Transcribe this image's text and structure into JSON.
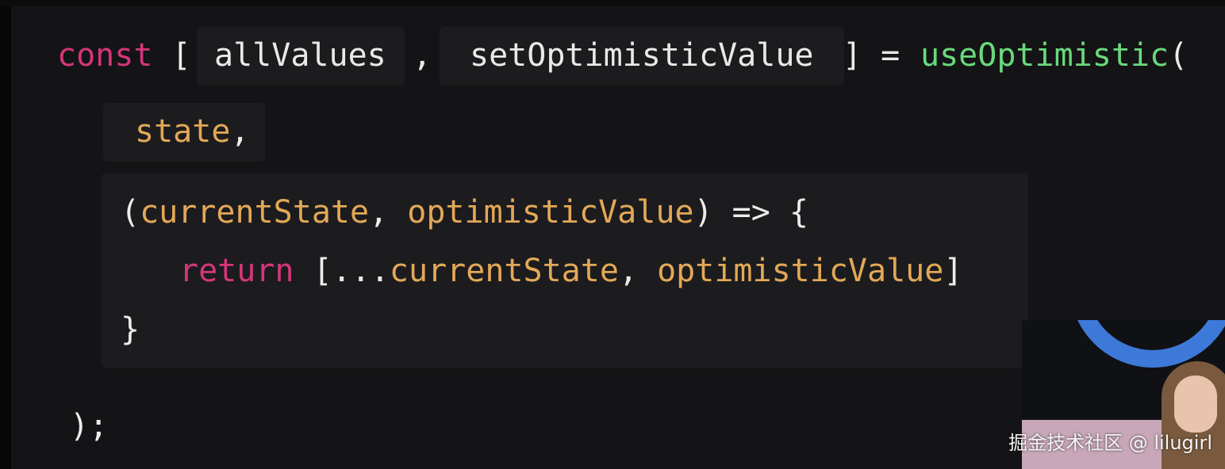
{
  "code": {
    "line1": {
      "keyword": "const",
      "open_bracket": "[",
      "first_binding": "allValues",
      "comma": ",",
      "second_binding": "setOptimisticValue",
      "close_and_assign": "] =",
      "hook_name": "useOptimistic",
      "open_paren": "("
    },
    "line2": {
      "arg": "state",
      "comma": ","
    },
    "line3": {
      "open_paren": "(",
      "param1": "currentState",
      "comma": ",",
      "param2": "optimisticValue",
      "arrow": ") => {"
    },
    "line4": {
      "keyword": "return",
      "spread_open": "[...",
      "item1": "currentState",
      "comma": ",",
      "item2": "optimisticValue",
      "close": "]"
    },
    "line5": {
      "brace": "}"
    },
    "line6": {
      "close": ");"
    }
  },
  "watermark": "掘金技术社区 @ lilugirl",
  "colors": {
    "background": "#141416",
    "keyword": "#d4367a",
    "function": "#69d97c",
    "variable": "#e3a857",
    "highlight_box": "#1c1c1f"
  }
}
